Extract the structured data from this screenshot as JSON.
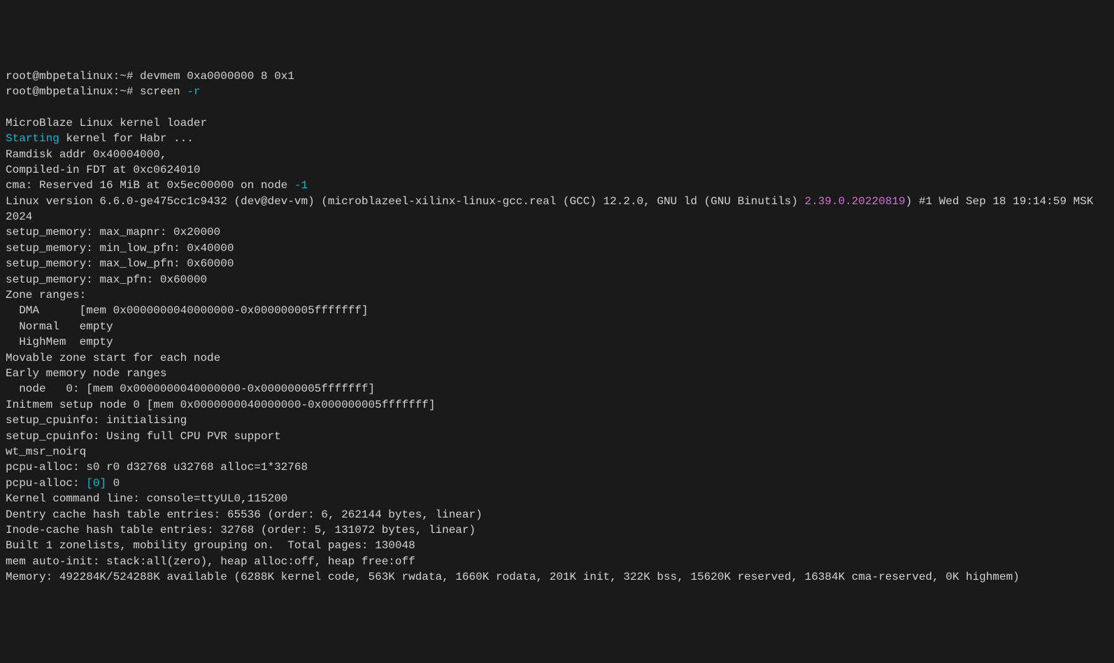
{
  "prompt1": "root@mbpetalinux:~# ",
  "cmd1": "devmem 0xa0000000 8 0x1",
  "prompt2": "root@mbpetalinux:~# ",
  "cmd2": "screen ",
  "cmd2_arg": "-r",
  "blank": "",
  "l_loader": "MicroBlaze Linux kernel loader",
  "l_starting_cyan": "Starting",
  "l_starting_rest": " kernel for Habr ...",
  "l_ramdisk": "Ramdisk addr 0x40004000,",
  "l_compiled": "Compiled-in FDT at 0xc0624010",
  "l_cma_pre": "cma: Reserved 16 MiB at 0x5ec00000 on node ",
  "l_cma_neg1": "-1",
  "l_linux_pre": "Linux version 6.6.0-ge475cc1c9432 (dev@dev-vm) (microblazeel-xilinx-linux-gcc.real (GCC) 12.2.0, GNU ld (GNU Binutils) ",
  "l_linux_mag": "2.39.0.20220819",
  "l_linux_post": ") #1 Wed Sep 18 19:14:59 MSK 2024",
  "l_setup1": "setup_memory: max_mapnr: 0x20000",
  "l_setup2": "setup_memory: min_low_pfn: 0x40000",
  "l_setup3": "setup_memory: max_low_pfn: 0x60000",
  "l_setup4": "setup_memory: max_pfn: 0x60000",
  "l_zone": "Zone ranges:",
  "l_dma": "  DMA      [mem 0x0000000040000000-0x000000005fffffff]",
  "l_normal": "  Normal   empty",
  "l_highmem": "  HighMem  empty",
  "l_movable": "Movable zone start for each node",
  "l_early": "Early memory node ranges",
  "l_node0": "  node   0: [mem 0x0000000040000000-0x000000005fffffff]",
  "l_initmem": "Initmem setup node 0 [mem 0x0000000040000000-0x000000005fffffff]",
  "l_cpuinfo1": "setup_cpuinfo: initialising",
  "l_cpuinfo2": "setup_cpuinfo: Using full CPU PVR support",
  "l_wtmsr": "wt_msr_noirq",
  "l_pcpu1": "pcpu-alloc: s0 r0 d32768 u32768 alloc=1*32768",
  "l_pcpu2_pre": "pcpu-alloc: ",
  "l_pcpu2_cyan": "[0]",
  "l_pcpu2_post": " 0",
  "l_cmdline": "Kernel command line: console=ttyUL0,115200",
  "l_dentry": "Dentry cache hash table entries: 65536 (order: 6, 262144 bytes, linear)",
  "l_inode": "Inode-cache hash table entries: 32768 (order: 5, 131072 bytes, linear)",
  "l_built": "Built 1 zonelists, mobility grouping on.  Total pages: 130048",
  "l_memauto": "mem auto-init: stack:all(zero), heap alloc:off, heap free:off",
  "l_memory": "Memory: 492284K/524288K available (6288K kernel code, 563K rwdata, 1660K rodata, 201K init, 322K bss, 15620K reserved, 16384K cma-reserved, 0K highmem)"
}
